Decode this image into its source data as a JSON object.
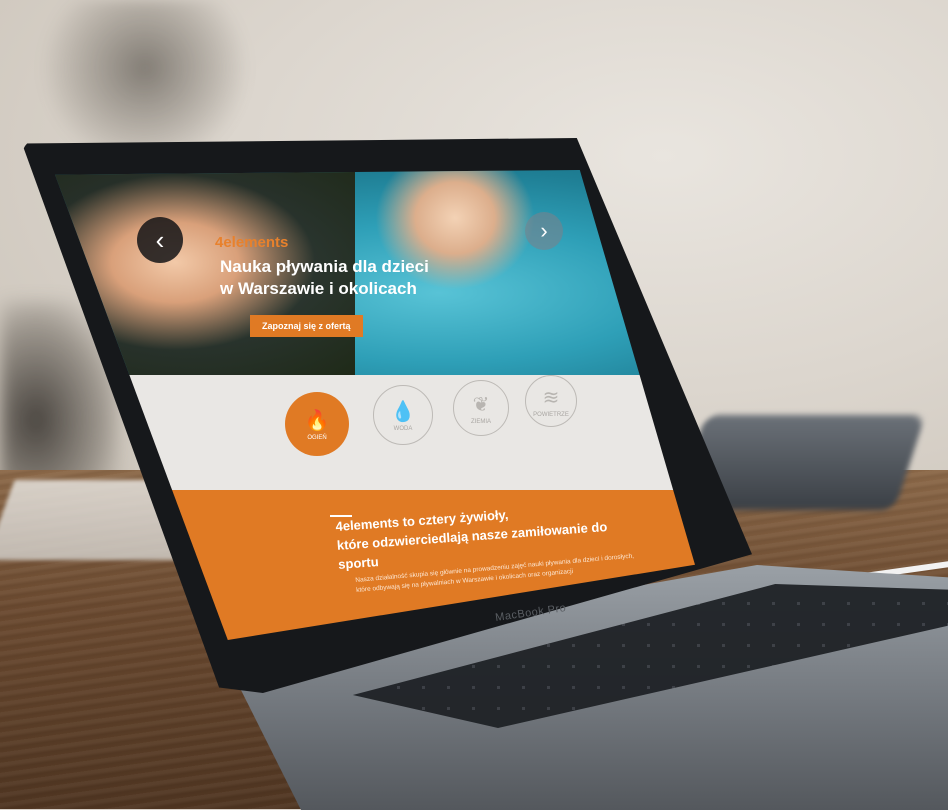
{
  "site": {
    "brand": "4elements",
    "headline_line1": "Nauka pływania dla dzieci",
    "headline_line2": "w Warszawie i okolicach",
    "cta_label": "Zapoznaj się z ofertą",
    "nav": {
      "prev": "‹",
      "next": "›"
    }
  },
  "elements": [
    {
      "label": "OGIEŃ",
      "icon": "flame-icon",
      "glyph": "🔥"
    },
    {
      "label": "WODA",
      "icon": "droplet-icon",
      "glyph": "💧"
    },
    {
      "label": "ZIEMIA",
      "icon": "leaf-icon",
      "glyph": "❦"
    },
    {
      "label": "POWIETRZE",
      "icon": "wind-icon",
      "glyph": "≋"
    }
  ],
  "about": {
    "title_line1": "4elements to cztery żywioły,",
    "title_line2": "które odzwierciedlają nasze zamiłowanie do sportu",
    "body": "Nasza działalność skupia się głównie na prowadzeniu zajęć nauki pływania dla dzieci i dorosłych, które odbywają się na pływalniach w Warszawie i okolicach oraz organizacji"
  },
  "device": {
    "model": "MacBook Pro"
  },
  "colors": {
    "accent": "#e07a24",
    "band_light": "#e9e7e4"
  }
}
